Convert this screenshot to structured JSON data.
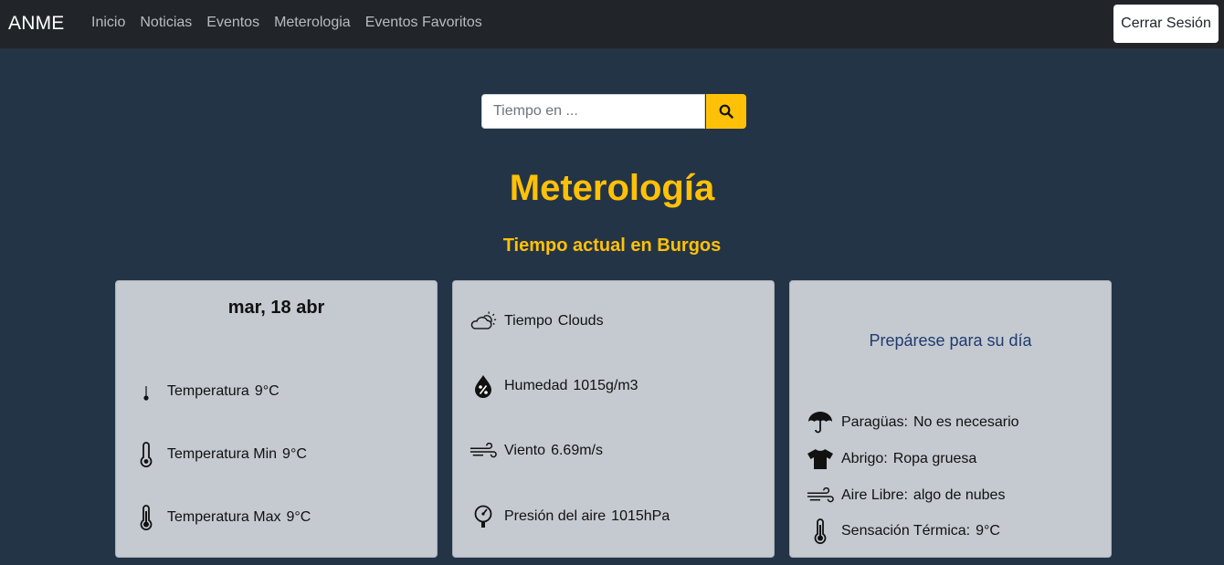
{
  "nav": {
    "brand": "ANME",
    "links": [
      "Inicio",
      "Noticias",
      "Eventos",
      "Meterologia",
      "Eventos Favoritos"
    ],
    "logout": "Cerrar Sesión"
  },
  "search": {
    "placeholder": "Tiempo en ...",
    "button_icon": "search-icon"
  },
  "title": "Meterología",
  "subtitle": "Tiempo actual en Burgos",
  "card1": {
    "date": "mar, 18 abr",
    "rows": [
      {
        "icon": "thermometer-low-icon",
        "label": "Temperatura",
        "value": "9°C"
      },
      {
        "icon": "thermometer-icon",
        "label": "Temperatura Min",
        "value": "9°C"
      },
      {
        "icon": "thermometer-full-icon",
        "label": "Temperatura Max",
        "value": "9°C"
      }
    ]
  },
  "card2": {
    "rows": [
      {
        "icon": "cloud-sun-icon",
        "label": "Tiempo",
        "value": "Clouds"
      },
      {
        "icon": "humidity-icon",
        "label": "Humedad",
        "value": "1015g/m3"
      },
      {
        "icon": "wind-icon",
        "label": "Viento",
        "value": "6.69m/s"
      },
      {
        "icon": "pressure-gauge-icon",
        "label": "Presión del aire",
        "value": "1015hPa"
      }
    ]
  },
  "card3": {
    "heading": "Prepárese para su día",
    "rows": [
      {
        "icon": "umbrella-icon",
        "label": "Paragüas:",
        "value": "No es necesario"
      },
      {
        "icon": "shirt-icon",
        "label": "Abrigo:",
        "value": "Ropa gruesa"
      },
      {
        "icon": "wind-icon",
        "label": "Aire Libre:",
        "value": "algo de nubes"
      },
      {
        "icon": "thermometer-full-icon",
        "label": "Sensación Térmica:",
        "value": "9°C"
      }
    ]
  },
  "colors": {
    "accent": "#ffc107",
    "background": "#243447",
    "navbar": "#212529",
    "card": "#c5cad1"
  }
}
